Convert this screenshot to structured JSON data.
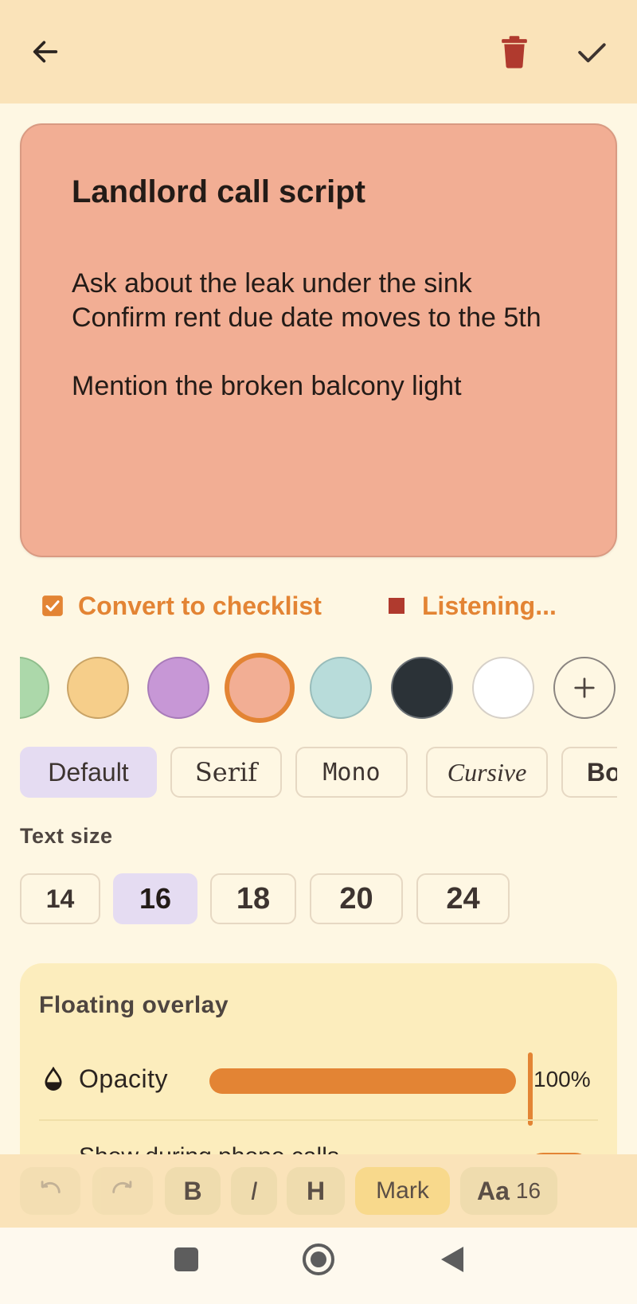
{
  "note": {
    "title": "Landlord call script",
    "body": "Ask about the leak under the sink\nConfirm rent due date moves to the 5th\n\nMention the broken balcony light"
  },
  "actions": {
    "convert_label": "Convert to checklist",
    "listening_label": "Listening..."
  },
  "colors": {
    "accent": "#e38434",
    "delete": "#b03a2e",
    "swatches": [
      "#acd8aa",
      "#f6ce8a",
      "#c797d6",
      "#f2ae94",
      "#b8dcda",
      "#2b3237",
      "#ffffff"
    ],
    "selected_swatch": "#f2ae94"
  },
  "fonts": {
    "options": [
      "Default",
      "Serif",
      "Mono",
      "Cursive",
      "Bo"
    ],
    "selected": "Default"
  },
  "text_size": {
    "label": "Text size",
    "options": [
      "14",
      "16",
      "18",
      "20",
      "24"
    ],
    "selected": "16"
  },
  "overlay": {
    "title": "Floating overlay",
    "opacity_label": "Opacity",
    "opacity_value": "100%",
    "opacity_fraction": 1.0,
    "phone_calls_label": "Show during phone calls"
  },
  "toolbar": {
    "bold": "B",
    "italic": "I",
    "heading": "H",
    "mark": "Mark",
    "font_size_prefix": "Aa",
    "font_size_value": "16"
  },
  "icons": {
    "back": "arrow-left-icon",
    "delete": "trash-icon",
    "save": "check-icon",
    "checklist": "checkbox-icon",
    "listening": "stop-icon",
    "add_color": "plus-icon",
    "opacity": "water-drop-icon",
    "undo": "undo-icon",
    "redo": "redo-icon",
    "nav_recents": "square-icon",
    "nav_home": "circle-icon",
    "nav_back": "triangle-back-icon"
  }
}
